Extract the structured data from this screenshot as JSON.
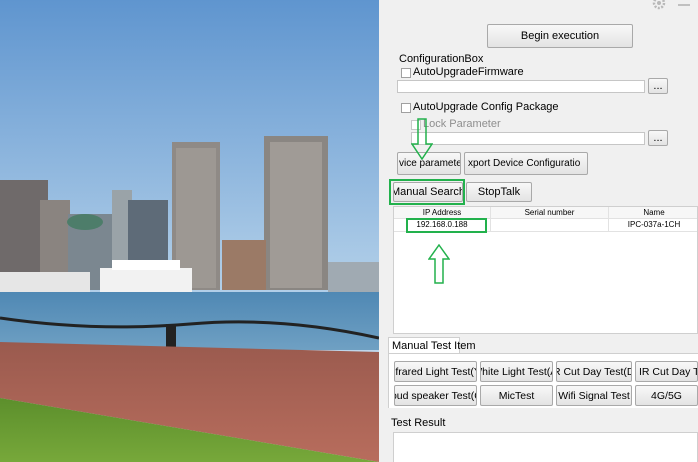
{
  "toolbar": {
    "begin_label": "Begin execution"
  },
  "config": {
    "title": "ConfigurationBox",
    "auto_upgrade_firmware": "AutoUpgradeFirmware",
    "auto_upgrade_config": "AutoUpgrade Config Package",
    "lock_parameter": "Lock Parameter",
    "browse_label": "...",
    "device_param_mod_label": "vice parameter modificati",
    "export_config_label": "xport Device Configuratio"
  },
  "search": {
    "manual_search_label": "Manual Search",
    "stop_talk_label": "StopTalk"
  },
  "devices": {
    "columns": [
      "IP Address",
      "Serial number",
      "Name"
    ],
    "rows": [
      {
        "ip": "192.168.0.188",
        "serial": "",
        "name": "IPC-037a-1CH"
      }
    ]
  },
  "manual_test": {
    "tab_label": "Manual Test Item",
    "row1": [
      "Infrared Light Test(Y)",
      "White Light Test(A)",
      "IR Cut Day Test(D)",
      "IR Cut Day Test("
    ],
    "row2": [
      "Loud speaker Test(Q)",
      "MicTest",
      "Wifi Signal Test",
      "4G/5G"
    ]
  },
  "result": {
    "title": "Test Result"
  },
  "colors": {
    "highlight": "#22b14c",
    "window_bg": "#f0f0f0"
  },
  "icons": {
    "settings": "gear-icon",
    "minimize": "minimize-icon"
  }
}
